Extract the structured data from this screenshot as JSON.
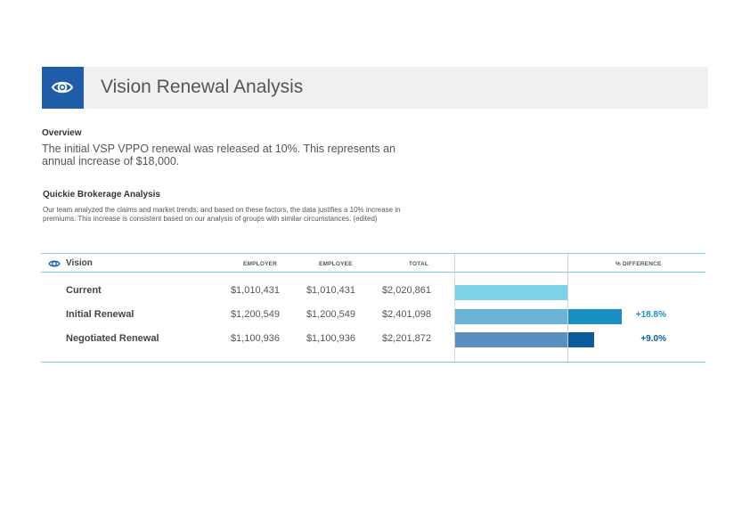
{
  "header": {
    "title": "Vision Renewal Analysis",
    "icon": "eye-icon",
    "accent": "#1f5da8"
  },
  "overview": {
    "heading": "Overview",
    "text": "The initial VSP VPPO renewal was released at 10%. This represents an annual increase of $18,000."
  },
  "brokerage": {
    "heading": "Quickie Brokerage Analysis",
    "text": "Our team analyzed the claims and market trends, and based on these factors, the data justifies a 10% increase in premiums. This increase is consistent based on our analysis of groups with similar circumstances. (edited)"
  },
  "table": {
    "title": "Vision",
    "columns": {
      "employer": "EMPLOYER",
      "employee": "EMPLOYEE",
      "total": "TOTAL",
      "pct": "% DIFFERENCE"
    },
    "rows": [
      {
        "label": "Current",
        "employer": "$1,010,431",
        "employee": "$1,010,431",
        "total": "$2,020,861",
        "pct": "",
        "base_color": "#7ed4e6",
        "diff_color": "",
        "diff_value": 0
      },
      {
        "label": "Initial Renewal",
        "employer": "$1,200,549",
        "employee": "$1,200,549",
        "total": "$2,401,098",
        "pct": "+18.8%",
        "base_color": "#6ab4d6",
        "diff_color": "#1a8fc3",
        "diff_value": 18.8
      },
      {
        "label": "Negotiated Renewal",
        "employer": "$1,100,936",
        "employee": "$1,100,936",
        "total": "$2,201,872",
        "pct": "+9.0%",
        "base_color": "#5b8fbf",
        "diff_color": "#0b5a9c",
        "diff_value": 9.0
      }
    ],
    "pct_colors": [
      "#1a8fc3",
      "#0b5a9c"
    ]
  }
}
